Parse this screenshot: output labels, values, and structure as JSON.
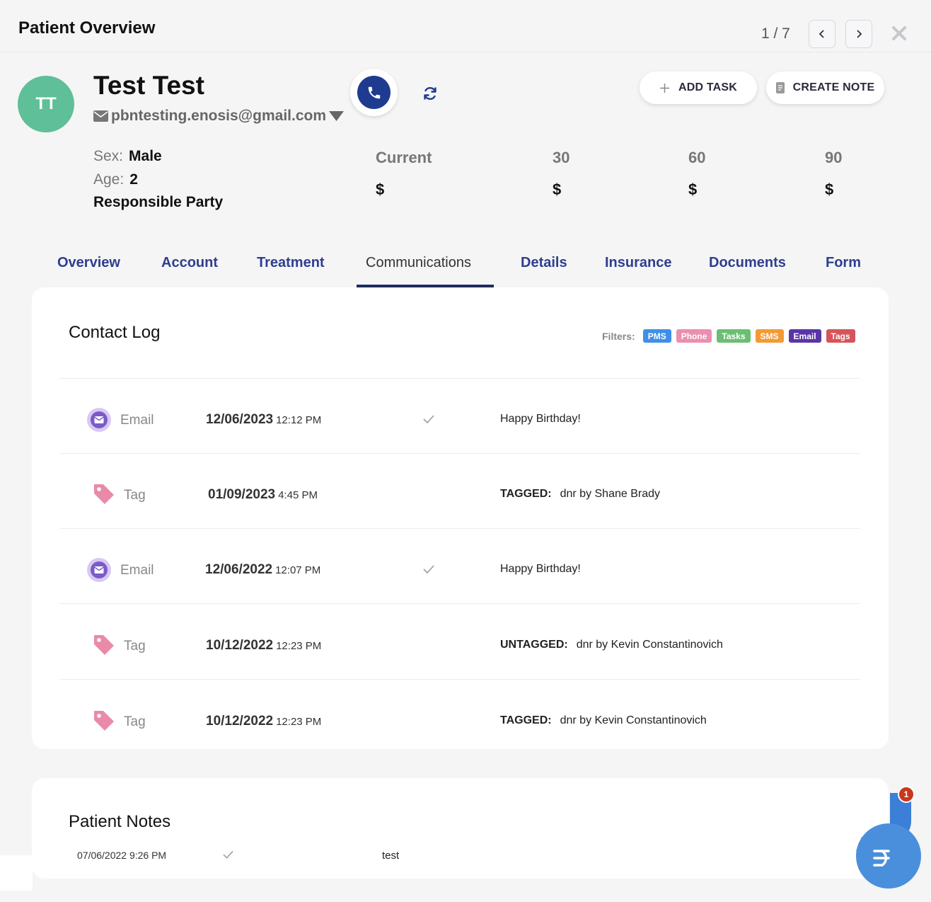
{
  "header": {
    "title": "Patient Overview",
    "pager": "1 / 7"
  },
  "patient": {
    "initials": "TT",
    "name": "Test Test",
    "email": "pbntesting.enosis@gmail.com",
    "sex_label": "Sex:",
    "sex": "Male",
    "age_label": "Age:",
    "age": "2",
    "responsible_party": "Responsible Party"
  },
  "actions": {
    "add_task": "ADD TASK",
    "create_note": "CREATE NOTE"
  },
  "balances": [
    {
      "label": "Current",
      "value": "$"
    },
    {
      "label": "30",
      "value": "$"
    },
    {
      "label": "60",
      "value": "$"
    },
    {
      "label": "90",
      "value": "$"
    }
  ],
  "tabs": [
    {
      "label": "Overview"
    },
    {
      "label": "Account"
    },
    {
      "label": "Treatment"
    },
    {
      "label": "Communications",
      "active": true
    },
    {
      "label": "Details"
    },
    {
      "label": "Insurance"
    },
    {
      "label": "Documents"
    },
    {
      "label": "Form"
    }
  ],
  "contact_log": {
    "title": "Contact Log",
    "filters_label": "Filters:",
    "filters": [
      {
        "label": "PMS",
        "color": "#3f8fe8"
      },
      {
        "label": "Phone",
        "color": "#eb8fb0"
      },
      {
        "label": "Tasks",
        "color": "#6bbf72"
      },
      {
        "label": "SMS",
        "color": "#f39a34"
      },
      {
        "label": "Email",
        "color": "#5a35a6"
      },
      {
        "label": "Tags",
        "color": "#d6545a"
      }
    ],
    "rows": [
      {
        "type": "Email",
        "icon": "email-icon",
        "date": "12/06/2023",
        "time": "12:12 PM",
        "checked": true,
        "prefix": "",
        "text": "Happy Birthday!"
      },
      {
        "type": "Tag",
        "icon": "tag-icon",
        "date": "01/09/2023",
        "time": "4:45 PM",
        "checked": false,
        "prefix": "TAGGED:",
        "text": "dnr by Shane Brady"
      },
      {
        "type": "Email",
        "icon": "email-icon",
        "date": "12/06/2022",
        "time": "12:07 PM",
        "checked": true,
        "prefix": "",
        "text": "Happy Birthday!"
      },
      {
        "type": "Tag",
        "icon": "tag-icon",
        "date": "10/12/2022",
        "time": "12:23 PM",
        "checked": false,
        "prefix": "UNTAGGED:",
        "text": "dnr by Kevin Constantinovich"
      },
      {
        "type": "Tag",
        "icon": "tag-icon",
        "date": "10/12/2022",
        "time": "12:23 PM",
        "checked": false,
        "prefix": "TAGGED:",
        "text": "dnr by Kevin Constantinovich"
      }
    ]
  },
  "patient_notes": {
    "title": "Patient Notes",
    "notes": [
      {
        "date": "07/06/2022 9:26 PM",
        "text": "test"
      }
    ]
  },
  "chat": {
    "badge_count": "1"
  },
  "colors": {
    "brand_navy": "#1f3b8f",
    "tab_color": "#2d3e8f",
    "avatar_green": "#5fbf98",
    "email_purple": "#7b5bc9",
    "tag_pink": "#ea8aa9",
    "chat_blue": "#4a8fdb"
  }
}
